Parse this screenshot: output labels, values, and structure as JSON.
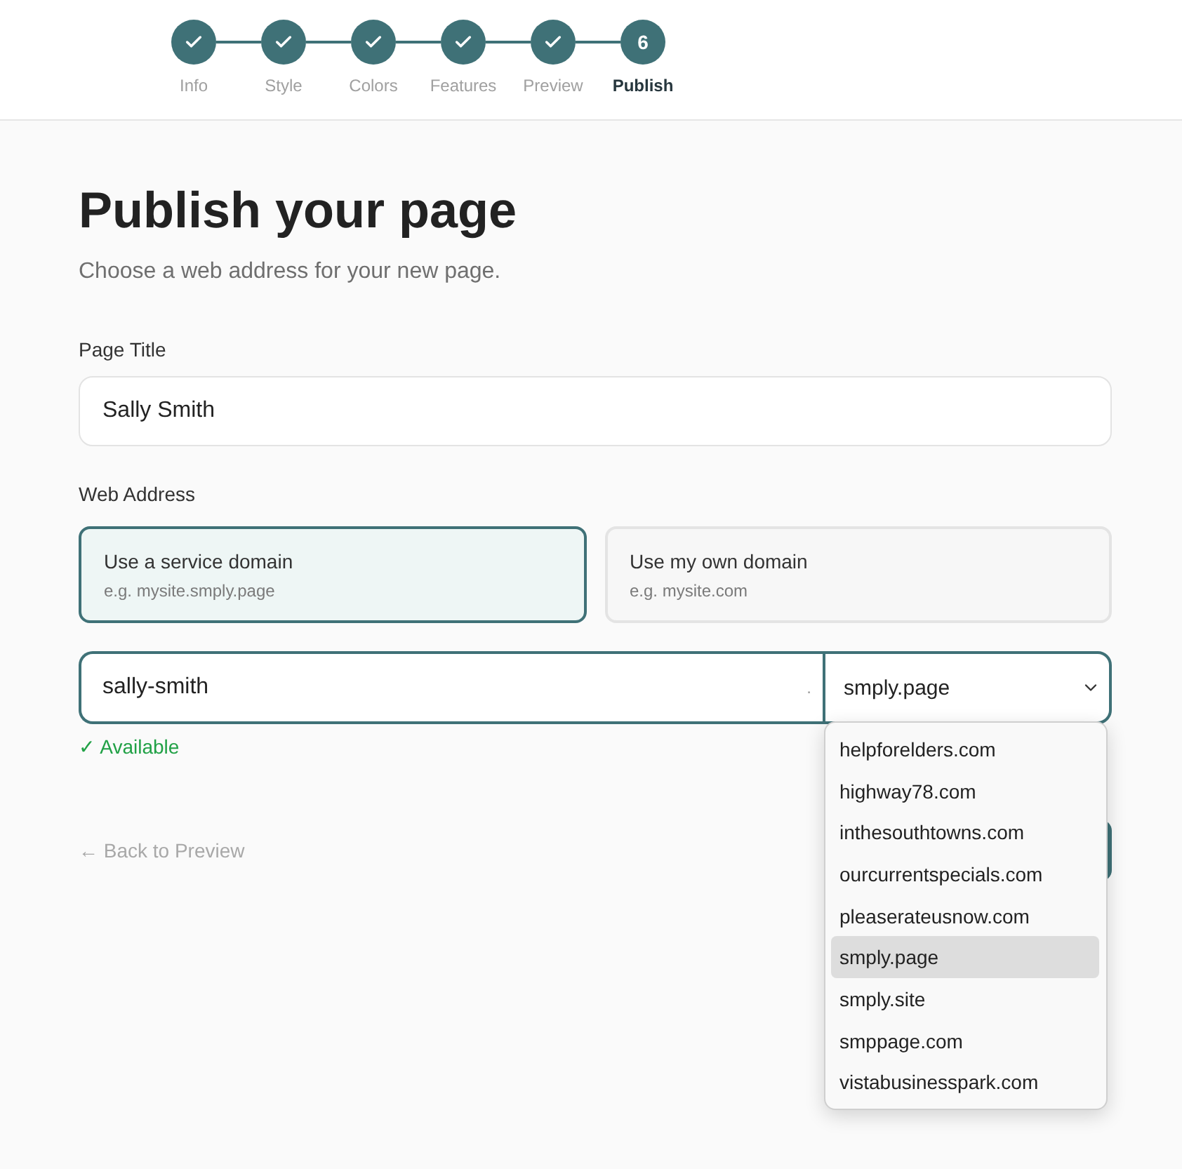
{
  "stepper": {
    "steps": [
      {
        "label": "Info",
        "done": true,
        "selected": false
      },
      {
        "label": "Style",
        "done": true,
        "selected": false
      },
      {
        "label": "Colors",
        "done": true,
        "selected": false
      },
      {
        "label": "Features",
        "done": true,
        "selected": false
      },
      {
        "label": "Preview",
        "done": true,
        "selected": false
      },
      {
        "label": "Publish",
        "done": false,
        "selected": true,
        "number": "6"
      }
    ]
  },
  "heading": "Publish your page",
  "subtitle": "Choose a web address for your new page.",
  "page_title": {
    "label": "Page Title",
    "value": "Sally Smith"
  },
  "web_address": {
    "label": "Web Address",
    "options": [
      {
        "title": "Use a service domain",
        "example": "e.g. mysite.smply.page",
        "selected": true
      },
      {
        "title": "Use my own domain",
        "example": "e.g. mysite.com",
        "selected": false
      }
    ],
    "subdomain": {
      "value": "sally-smith",
      "separator": "."
    },
    "domain_select": {
      "value": "smply.page",
      "open": true,
      "options": [
        {
          "label": "helpforelders.com",
          "selected": false
        },
        {
          "label": "highway78.com",
          "selected": false
        },
        {
          "label": "inthesouthtowns.com",
          "selected": false
        },
        {
          "label": "ourcurrentspecials.com",
          "selected": false
        },
        {
          "label": "pleaserateusnow.com",
          "selected": false
        },
        {
          "label": "smply.page",
          "selected": true
        },
        {
          "label": "smply.site",
          "selected": false
        },
        {
          "label": "smppage.com",
          "selected": false
        },
        {
          "label": "vistabusinesspark.com",
          "selected": false
        }
      ]
    },
    "status": "✓ Available"
  },
  "back_link": "← Back to Preview"
}
